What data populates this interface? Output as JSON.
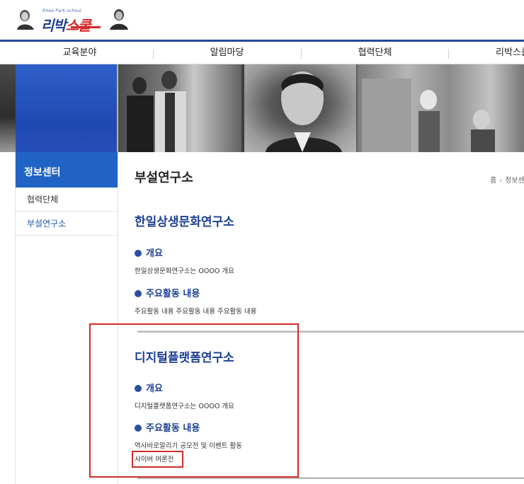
{
  "header": {
    "logo_en": "Rhee Park school",
    "logo_ko_part1": "리박",
    "logo_ko_part2": "스쿨"
  },
  "nav": {
    "items": [
      "교육분야",
      "알림마당",
      "협력단체",
      "리박스쿨"
    ]
  },
  "sidebar": {
    "title": "정보센터",
    "items": [
      {
        "label": "협력단체",
        "active": false
      },
      {
        "label": "부설연구소",
        "active": true
      }
    ]
  },
  "main": {
    "page_title": "부설연구소",
    "breadcrumb": {
      "home": "홈",
      "current": "정보센터"
    },
    "sections": [
      {
        "title": "한일상생문화연구소",
        "overview_label": "개요",
        "overview_text": "한일상생문화연구소는 OOOO 개요",
        "activities_label": "주요활동 내용",
        "activities_text": [
          "주요활동 내용 주요활동 내용 주요활동 내용"
        ]
      },
      {
        "title": "디지털플랫폼연구소",
        "overview_label": "개요",
        "overview_text": "디지털플랫폼연구소는 OOOO 개요",
        "activities_label": "주요활동 내용",
        "activities_text": [
          "역사바로알리기 공모전 및 이벤트 활동",
          "사이버 여론전"
        ]
      }
    ]
  },
  "colors": {
    "brand_blue": "#24489b",
    "side_head": "#1f63c4",
    "section_title": "#1c3f94",
    "annotation_red": "#d22b2b"
  }
}
